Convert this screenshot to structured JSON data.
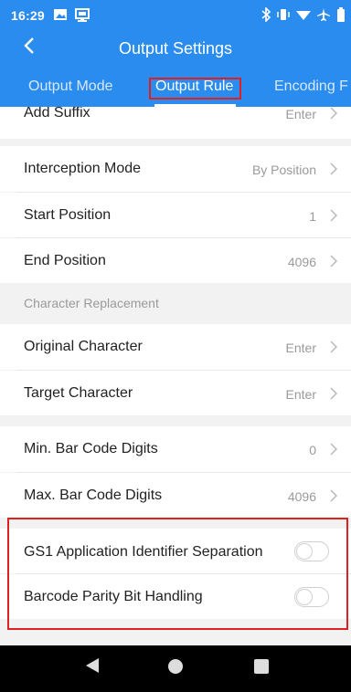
{
  "status_bar": {
    "time": "16:29",
    "left_icons": [
      "image-icon",
      "desktop-icon"
    ],
    "right_icons": [
      "bluetooth-icon",
      "vibrate-icon",
      "wifi-icon",
      "airplane-icon",
      "battery-icon"
    ]
  },
  "header": {
    "title": "Output Settings",
    "back_icon": "chevron-left-icon",
    "tabs": [
      {
        "label": "Output Mode",
        "active": false
      },
      {
        "label": "Output Rule",
        "active": true
      },
      {
        "label": "Encoding F",
        "active": false
      }
    ]
  },
  "settings": {
    "add_suffix": {
      "label": "Add Suffix",
      "value": "Enter"
    },
    "interception_mode": {
      "label": "Interception Mode",
      "value": "By Position"
    },
    "start_position": {
      "label": "Start Position",
      "value": "1"
    },
    "end_position": {
      "label": "End Position",
      "value": "4096"
    },
    "character_replacement": {
      "title": "Character Replacement",
      "original": {
        "label": "Original Character",
        "value": "Enter"
      },
      "target": {
        "label": "Target Character",
        "value": "Enter"
      }
    },
    "min_digits": {
      "label": "Min. Bar Code Digits",
      "value": "0"
    },
    "max_digits": {
      "label": "Max. Bar Code Digits",
      "value": "4096"
    },
    "gs1_separation": {
      "label": "GS1 Application Identifier Separation",
      "enabled": false
    },
    "parity_bit": {
      "label": "Barcode Parity Bit Handling",
      "enabled": false
    }
  },
  "colors": {
    "header_blue": "#2b8cf0",
    "highlight_red": "#e02020"
  }
}
